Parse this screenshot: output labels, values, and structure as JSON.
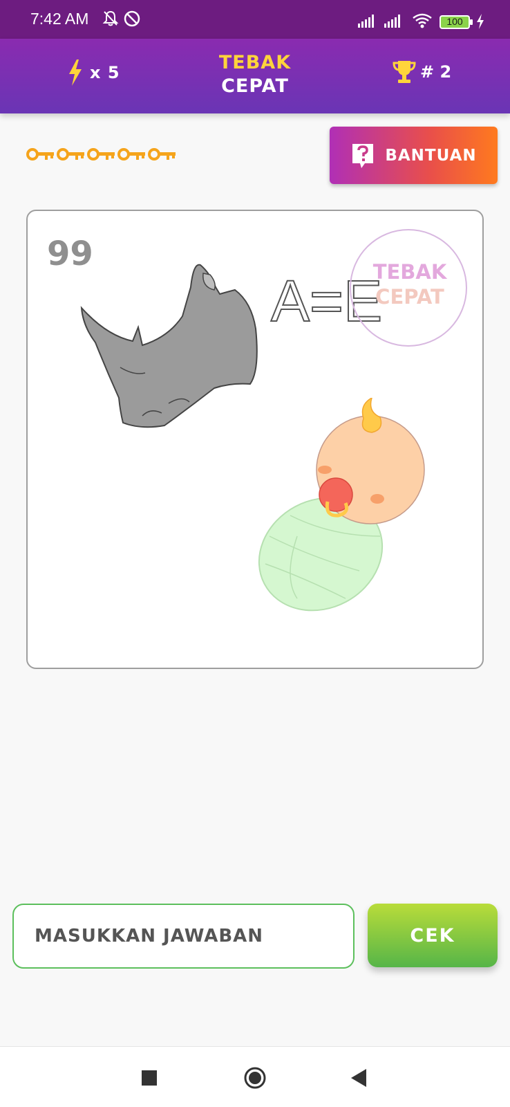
{
  "status_bar": {
    "time": "7:42 AM",
    "battery": "100",
    "icons": [
      "bell-off-icon",
      "do-not-disturb-icon",
      "signal-icon",
      "signal-icon",
      "wifi-icon",
      "battery-icon",
      "charging-icon"
    ]
  },
  "header": {
    "lives_label": "x 5",
    "title_line1": "TEBAK",
    "title_line2": "CEPAT",
    "rank_label": "# 2",
    "icons": [
      "lightning-icon",
      "trophy-icon"
    ],
    "colors": {
      "header_top": "#8a2bb0",
      "header_bottom": "#6a35b5",
      "title_accent": "#ffd43b",
      "lightning": "#ffd43b"
    }
  },
  "keys": {
    "count": 5,
    "icon": "key-icon",
    "color": "#f5a41c"
  },
  "help_button": {
    "label": "BANTUAN",
    "icon": "question-icon"
  },
  "question": {
    "level": "99",
    "equation": "A=E",
    "watermark_line1": "TEBAK",
    "watermark_line2": "CEPAT",
    "images": [
      "rhino-image",
      "baby-image"
    ]
  },
  "answer": {
    "placeholder": "MASUKKAN JAWABAN",
    "value": ""
  },
  "check_button": {
    "label": "CEK"
  },
  "nav_bar": {
    "icons": [
      "recents-square-icon",
      "home-circle-icon",
      "back-triangle-icon"
    ]
  }
}
